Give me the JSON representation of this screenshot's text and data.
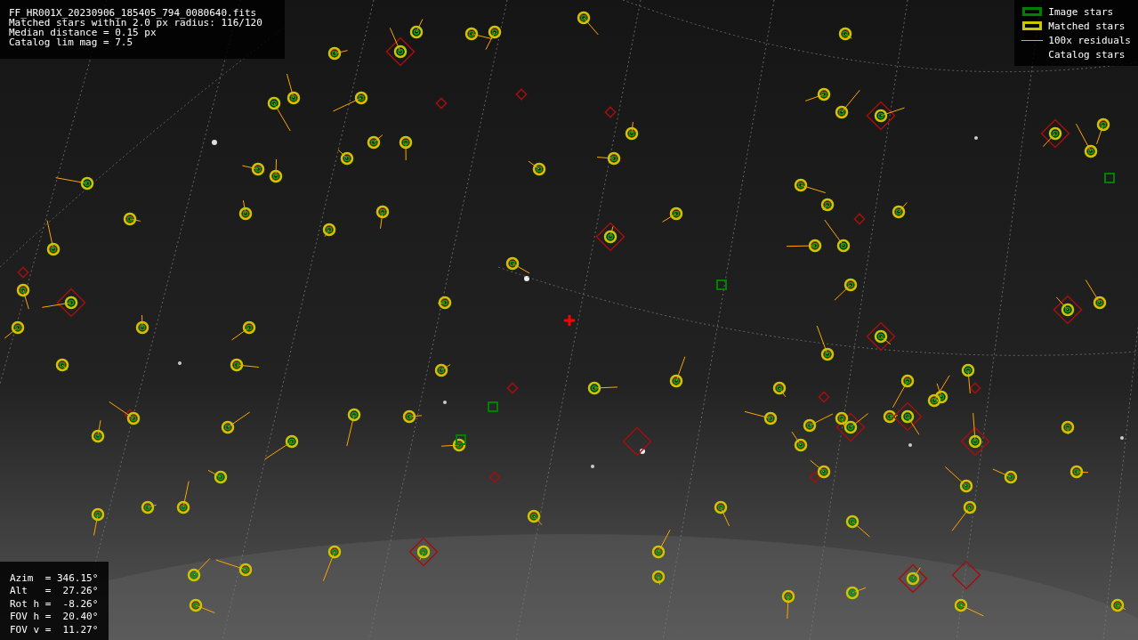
{
  "image_info": {
    "lines": [
      "FF_HR001X_20230906_185405_794_0080640.fits",
      "Matched stars within 2.0 px radius: 116/120",
      "Median distance = 0.15 px",
      "Catalog lim mag = 7.5"
    ]
  },
  "legend": [
    {
      "kind": "box",
      "color": "#008000",
      "label": "Image stars"
    },
    {
      "kind": "box",
      "color": "#c8c800",
      "label": "Matched stars"
    },
    {
      "kind": "line",
      "color": "#ffa500",
      "label": "100x residuals"
    },
    {
      "kind": "none",
      "label": "Catalog stars"
    }
  ],
  "pointing_info": {
    "lines": [
      "Azim  = 346.15°",
      "Alt   =  27.26°",
      "Rot h =  -8.26°",
      "FOV h =  20.40°",
      "FOV v =  11.27°"
    ]
  }
}
